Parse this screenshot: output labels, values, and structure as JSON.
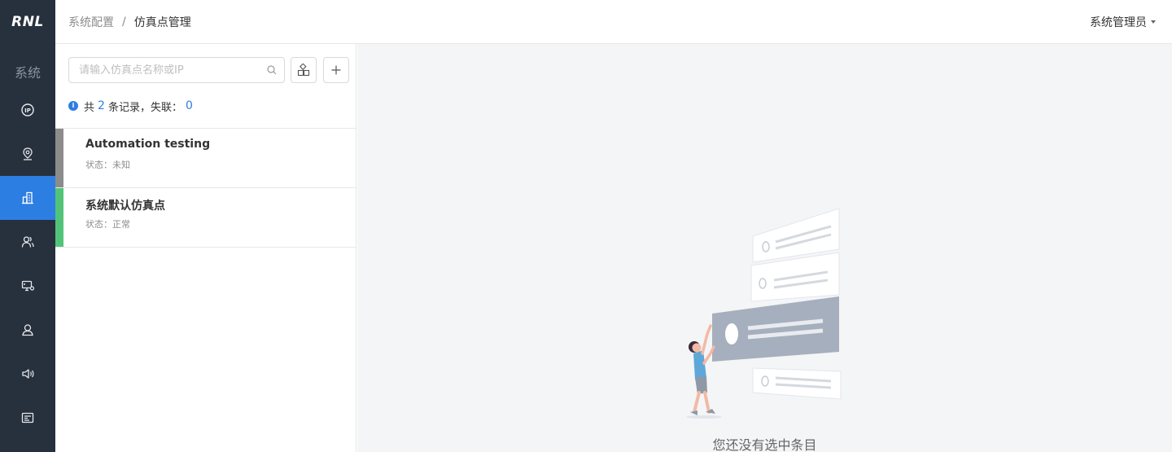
{
  "app": {
    "logo": "RNL",
    "section_label": "系统"
  },
  "sidebar": {
    "items": [
      {
        "icon": "ip-icon",
        "active": false
      },
      {
        "icon": "location-pin-icon",
        "active": false
      },
      {
        "icon": "building-icon",
        "active": true
      },
      {
        "icon": "users-icon",
        "active": false
      },
      {
        "icon": "network-icon",
        "active": false
      },
      {
        "icon": "user-icon",
        "active": false
      },
      {
        "icon": "speaker-icon",
        "active": false
      },
      {
        "icon": "document-icon",
        "active": false
      }
    ]
  },
  "header": {
    "breadcrumb": {
      "parent": "系统配置",
      "separator": "/",
      "current": "仿真点管理"
    },
    "user_name": "系统管理员"
  },
  "list": {
    "search_placeholder": "请输入仿真点名称或IP",
    "stats": {
      "prefix": "共",
      "total": "2",
      "middle": "条记录，失联：",
      "lost": "0"
    },
    "items": [
      {
        "name": "Automation testing",
        "status": "状态：未知",
        "color": "#8c8c8c"
      },
      {
        "name": "系统默认仿真点",
        "status": "状态：正常",
        "color": "#52c47a"
      }
    ]
  },
  "detail": {
    "empty_text": "您还没有选中条目"
  },
  "colors": {
    "accent": "#2d7ee3",
    "sidebar_bg": "#27303d",
    "status_unknown": "#8c8c8c",
    "status_ok": "#52c47a"
  }
}
